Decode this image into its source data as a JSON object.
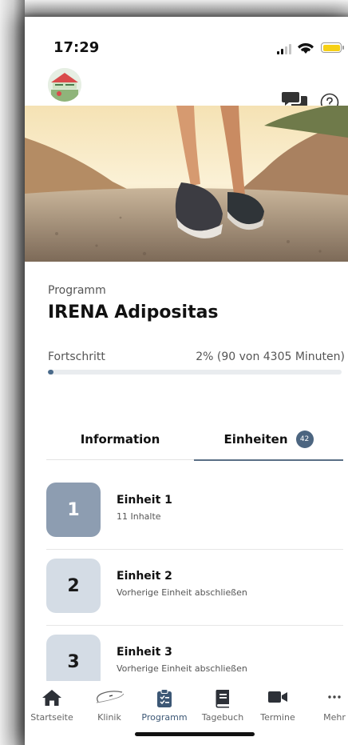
{
  "status_bar": {
    "time": "17:29"
  },
  "header": {
    "avatar_icon": "program-logo-avatar",
    "chat_icon": "chat-bubbles-icon",
    "help_icon": "help-icon"
  },
  "program": {
    "label": "Programm",
    "title": "IRENA Adipositas",
    "progress_label": "Fortschritt",
    "progress_text": "2% (90 von 4305 Minuten)",
    "progress_fraction": 0.02
  },
  "tabs": [
    {
      "label": "Information",
      "active": false
    },
    {
      "label": "Einheiten",
      "active": true,
      "badge": "42"
    }
  ],
  "units": [
    {
      "number": "1",
      "title": "Einheit 1",
      "subtitle": "11 Inhalte",
      "state": "active"
    },
    {
      "number": "2",
      "title": "Einheit 2",
      "subtitle": "Vorherige Einheit abschließen",
      "state": "locked"
    },
    {
      "number": "3",
      "title": "Einheit 3",
      "subtitle": "Vorherige Einheit abschließen",
      "state": "locked"
    }
  ],
  "bottom_nav": [
    {
      "label": "Startseite",
      "icon": "home-icon",
      "active": false
    },
    {
      "label": "Klinik",
      "icon": "clinic-logo-icon",
      "active": false
    },
    {
      "label": "Programm",
      "icon": "clipboard-icon",
      "active": true
    },
    {
      "label": "Tagebuch",
      "icon": "book-icon",
      "active": false
    },
    {
      "label": "Termine",
      "icon": "video-camera-icon",
      "active": false
    },
    {
      "label": "Mehr",
      "icon": "more-dots-icon",
      "active": false
    }
  ],
  "colors": {
    "accent": "#4c6580",
    "unit_active": "#8d9db1",
    "unit_locked": "#d4dce5"
  }
}
